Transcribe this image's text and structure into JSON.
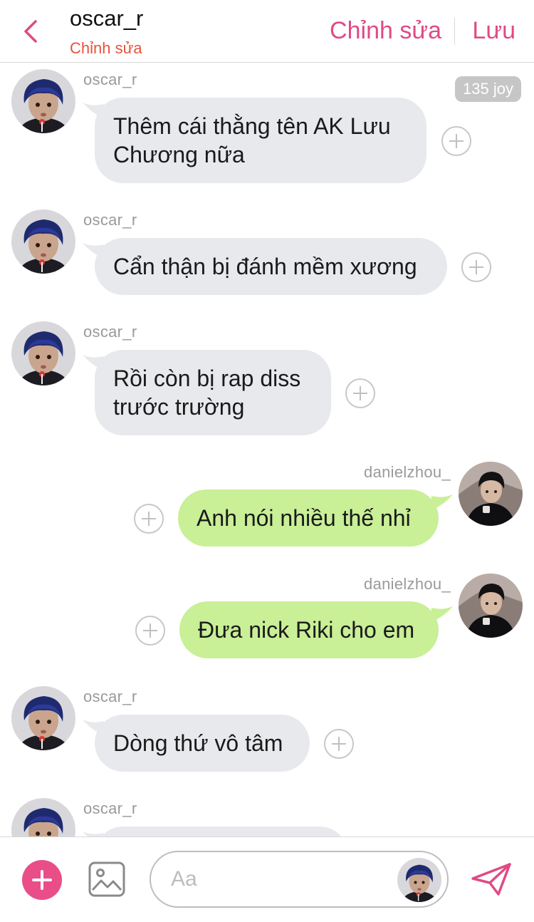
{
  "header": {
    "title": "oscar_r",
    "subtitle": "Chỉnh sửa",
    "edit_label": "Chỉnh sửa",
    "save_label": "Lưu"
  },
  "joy_badge": "135 joy",
  "messages": [
    {
      "side": "left",
      "sender": "oscar_r",
      "lines": [
        "Thêm cái thằng tên AK Lưu",
        "Chương nữa"
      ]
    },
    {
      "side": "left",
      "sender": "oscar_r",
      "lines": [
        "Cẩn thận bị đánh mềm xương"
      ]
    },
    {
      "side": "left",
      "sender": "oscar_r",
      "lines": [
        "Rồi còn bị rap diss",
        "trước trường"
      ]
    },
    {
      "side": "right",
      "sender": "danielzhou_",
      "lines": [
        "Anh nói nhiều thế nhỉ"
      ]
    },
    {
      "side": "right",
      "sender": "danielzhou_",
      "lines": [
        "Đưa nick Riki cho em"
      ]
    },
    {
      "side": "left",
      "sender": "oscar_r",
      "lines": [
        "Dòng thứ vô tâm"
      ]
    },
    {
      "side": "left",
      "sender": "oscar_r",
      "lines": [
        ""
      ]
    }
  ],
  "input": {
    "placeholder": "Aa",
    "value": ""
  },
  "colors": {
    "accent": "#e94e88",
    "left_bubble": "#e7e9ec",
    "right_bubble": "#c9ef97",
    "subtitle": "#e5533d"
  },
  "icons": {
    "back": "chevron-left-icon",
    "add": "plus-icon",
    "image": "image-icon",
    "send": "paper-plane-icon",
    "react": "plus-circle-icon"
  }
}
